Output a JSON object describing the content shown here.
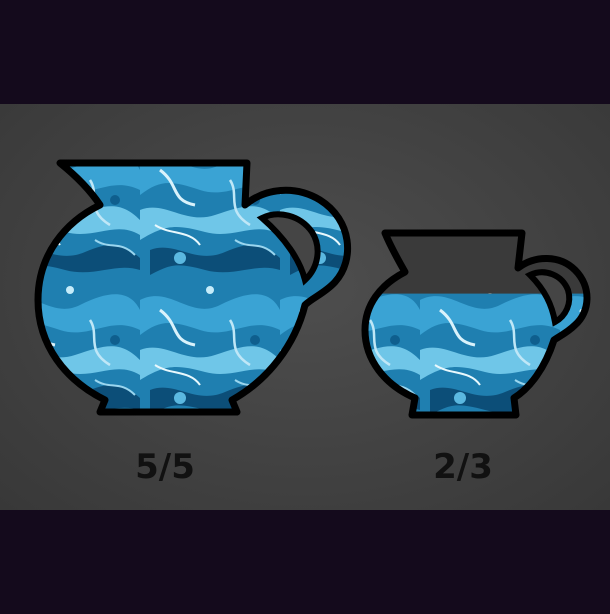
{
  "jugs": [
    {
      "label": "5/5",
      "fill_fraction": 1.0
    },
    {
      "label": "2/3",
      "fill_fraction": 0.667
    }
  ],
  "colors": {
    "background": "#140a1c",
    "board": "#454545",
    "water_base": "#1f7fb0",
    "water_light": "#6fc6e8",
    "water_dark": "#0c4e78",
    "empty": "#3a3a3a",
    "outline": "#000000"
  }
}
